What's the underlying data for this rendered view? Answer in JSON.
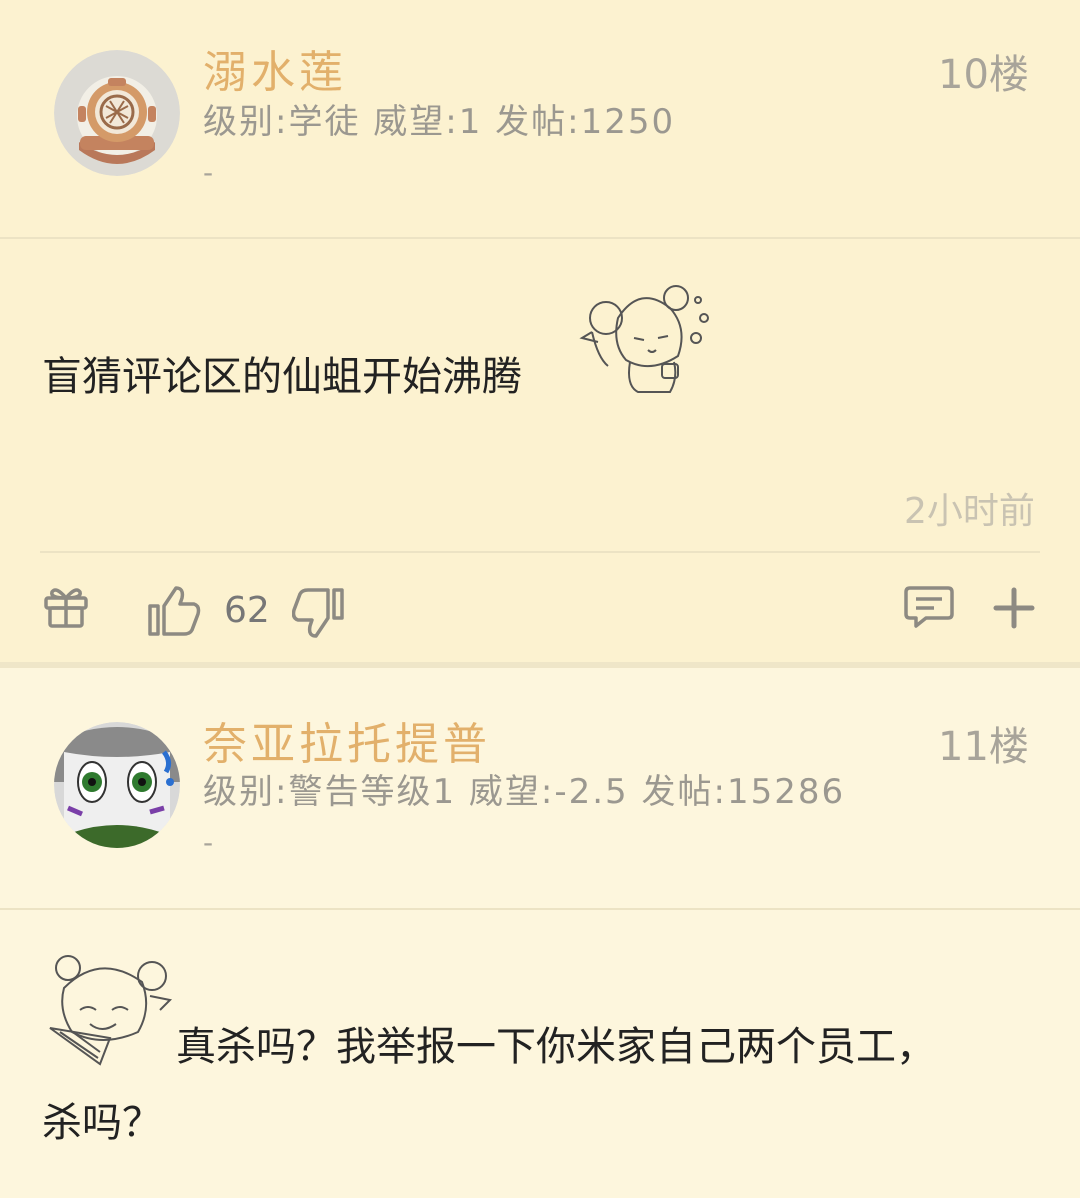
{
  "posts": [
    {
      "username": "溺水莲",
      "floor": "10楼",
      "meta": "级别:学徒 威望:1 发帖:1250",
      "dash": "-",
      "content": "盲猜评论区的仙蛆开始沸腾",
      "time": "2小时前",
      "likes": "62"
    },
    {
      "username": "奈亚拉托提普",
      "floor": "11楼",
      "meta": "级别:警告等级1 威望:-2.5 发帖:15286",
      "dash": "-",
      "content_line1": "真杀吗？我举报一下你米家自己两个员工，",
      "content_line2": "杀吗？"
    }
  ],
  "icons": [
    "gift-icon",
    "thumbs-up-icon",
    "thumbs-down-icon",
    "comment-icon",
    "plus-icon"
  ]
}
